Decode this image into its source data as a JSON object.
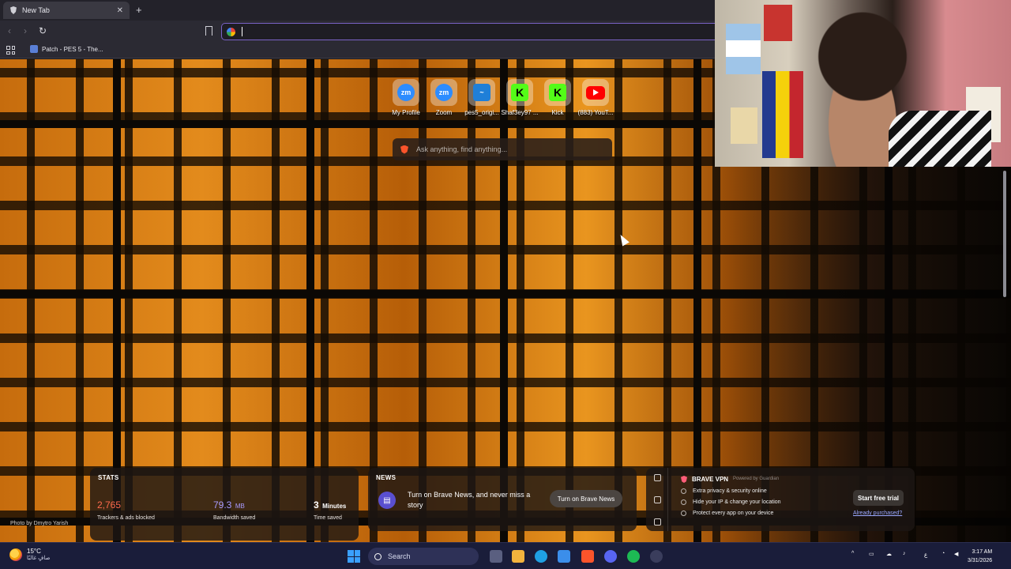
{
  "browser": {
    "tab_title": "New Tab",
    "tab_close": "✕",
    "new_tab": "+",
    "url_placeholder": "",
    "bookmark_item": "Patch - PES 5 - The..."
  },
  "top_sites": [
    {
      "label": "My Profile",
      "logo_text": "zm",
      "style": "zoom"
    },
    {
      "label": "Zoom",
      "logo_text": "zm",
      "style": "zoom"
    },
    {
      "label": "pes5_origi...",
      "logo_text": "~",
      "style": "pes"
    },
    {
      "label": "Shaf3ey97 ...",
      "logo_text": "K",
      "style": "kick"
    },
    {
      "label": "Kick",
      "logo_text": "K",
      "style": "kick"
    },
    {
      "label": "(883) YouT...",
      "logo_text": "",
      "style": "yt"
    }
  ],
  "search": {
    "placeholder": "Ask anything, find anything..."
  },
  "stats": {
    "heading": "STATS",
    "trackers_value": "2,765",
    "trackers_caption": "Trackers & ads blocked",
    "bandwidth_value": "79.3",
    "bandwidth_unit": "MB",
    "bandwidth_caption": "Bandwidth saved",
    "time_value": "3",
    "time_unit": "Minutes",
    "time_caption": "Time saved"
  },
  "news": {
    "heading": "NEWS",
    "text": "Turn on Brave News, and never miss a story",
    "button": "Turn on Brave News"
  },
  "vpn": {
    "title": "BRAVE VPN",
    "powered_by": "Powered by  Guardian",
    "features": [
      "Extra privacy & security online",
      "Hide your IP & change your location",
      "Protect every app on your device"
    ],
    "trial_button": "Start free trial",
    "already_link": "Already purchased?"
  },
  "photo_credit": "Photo by Dmytro Yarish",
  "taskbar": {
    "temperature": "15°C",
    "condition": "صافٍ غالبًا",
    "search_label": "Search",
    "input_lang": "ع",
    "time": "3:17 AM",
    "date": "3/31/2026"
  },
  "colors": {
    "accent": "#7a63c7",
    "stat_red": "#ff6a4d",
    "stat_purple": "#a99cff",
    "brave_orange": "#fb542b"
  }
}
